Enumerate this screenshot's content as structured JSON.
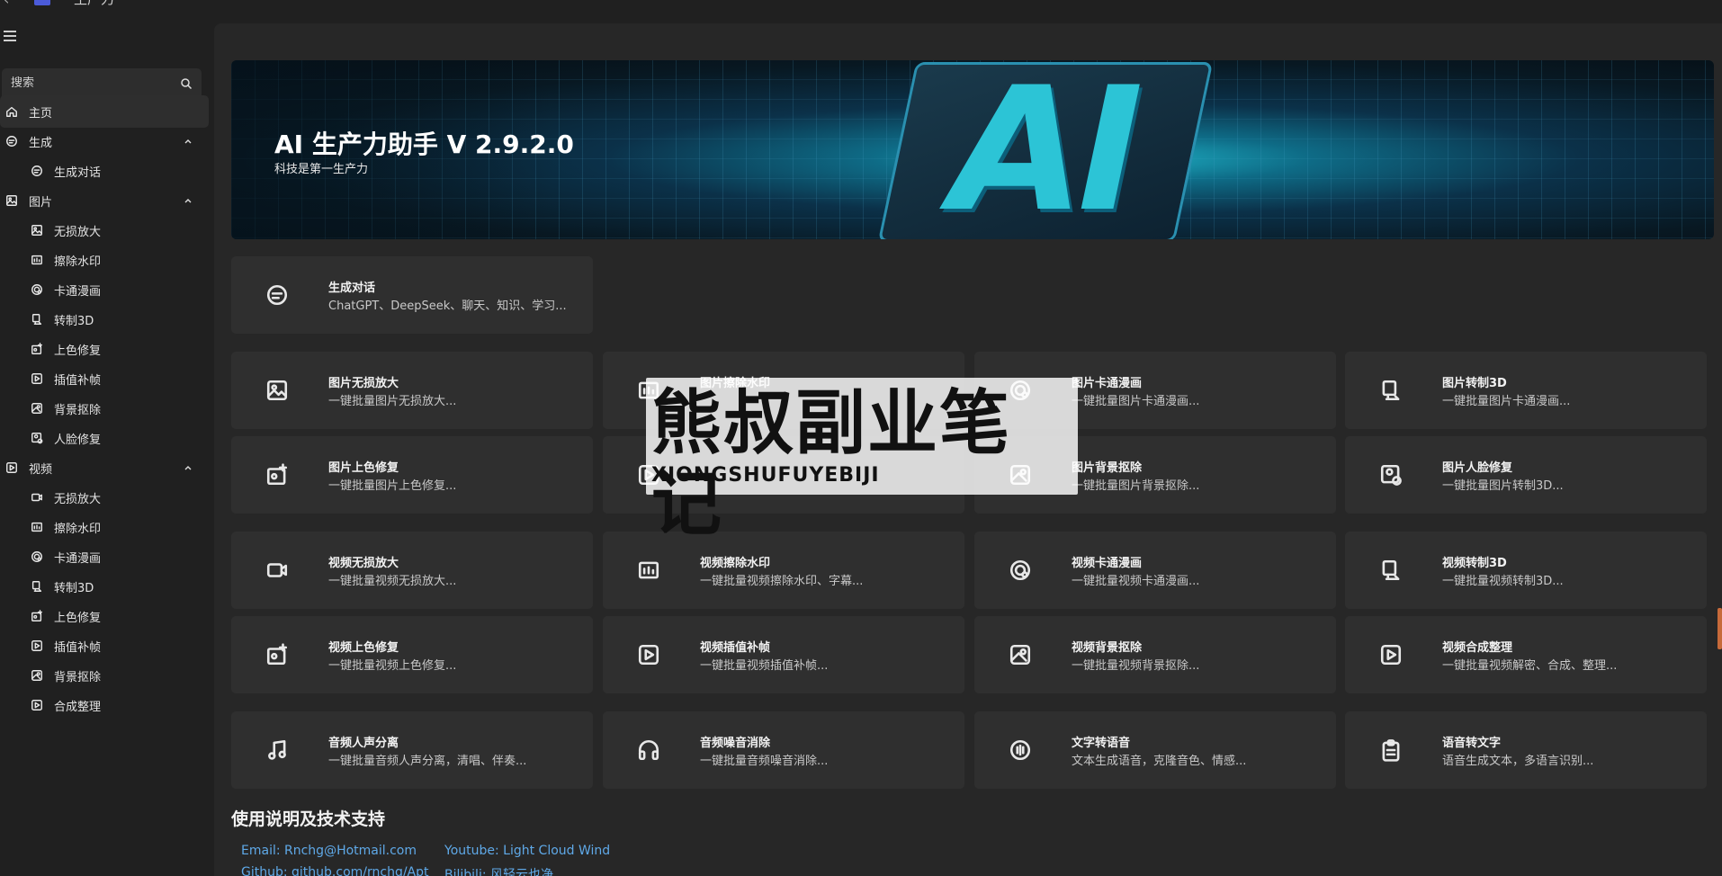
{
  "app": {
    "title": "生产力"
  },
  "sidebar": {
    "search_placeholder": "搜索",
    "items": [
      {
        "label": "主页",
        "icon": "home-icon"
      },
      {
        "label": "生成",
        "icon": "chat-icon"
      },
      {
        "label": "生成对话",
        "icon": "chat-icon"
      },
      {
        "label": "图片",
        "icon": "image-icon"
      },
      {
        "label": "无损放大",
        "icon": "image-icon"
      },
      {
        "label": "擦除水印",
        "icon": "watermark-icon"
      },
      {
        "label": "卡通漫画",
        "icon": "cartoon-icon"
      },
      {
        "label": "转制3D",
        "icon": "3d-icon"
      },
      {
        "label": "上色修复",
        "icon": "colorize-icon"
      },
      {
        "label": "插值补帧",
        "icon": "play-icon"
      },
      {
        "label": "背景抠除",
        "icon": "background-icon"
      },
      {
        "label": "人脸修复",
        "icon": "face-icon"
      },
      {
        "label": "视频",
        "icon": "video-icon"
      },
      {
        "label": "无损放大",
        "icon": "video-camera-icon"
      },
      {
        "label": "擦除水印",
        "icon": "watermark-icon"
      },
      {
        "label": "卡通漫画",
        "icon": "cartoon-icon"
      },
      {
        "label": "转制3D",
        "icon": "3d-icon"
      },
      {
        "label": "上色修复",
        "icon": "colorize-icon"
      },
      {
        "label": "插值补帧",
        "icon": "play-icon"
      },
      {
        "label": "背景抠除",
        "icon": "background-icon"
      },
      {
        "label": "合成整理",
        "icon": "play-icon"
      }
    ]
  },
  "banner": {
    "title": "AI 生产力助手 V 2.9.2.0",
    "subtitle": "科技是第一生产力",
    "art_text": "AI"
  },
  "cards": [
    {
      "title": "生成对话",
      "desc": "ChatGPT、DeepSeek、聊天、知识、学习...",
      "icon": "chat-icon"
    },
    {
      "title": "图片无损放大",
      "desc": "一键批量图片无损放大...",
      "icon": "image-icon"
    },
    {
      "title": "图片擦除水印",
      "desc": "",
      "icon": "watermark-icon"
    },
    {
      "title": "图片卡通漫画",
      "desc": "一键批量图片卡通漫画...",
      "icon": "cartoon-icon"
    },
    {
      "title": "图片转制3D",
      "desc": "一键批量图片卡通漫画...",
      "icon": "3d-icon"
    },
    {
      "title": "图片上色修复",
      "desc": "一键批量图片上色修复...",
      "icon": "colorize-icon"
    },
    {
      "title": "",
      "desc": "",
      "icon": "play-icon"
    },
    {
      "title": "图片背景抠除",
      "desc": "一键批量图片背景抠除...",
      "icon": "background-icon"
    },
    {
      "title": "图片人脸修复",
      "desc": "一键批量图片转制3D...",
      "icon": "face-icon"
    },
    {
      "title": "视频无损放大",
      "desc": "一键批量视频无损放大...",
      "icon": "video-camera-icon"
    },
    {
      "title": "视频擦除水印",
      "desc": "一键批量视频擦除水印、字幕...",
      "icon": "watermark-icon"
    },
    {
      "title": "视频卡通漫画",
      "desc": "一键批量视频卡通漫画...",
      "icon": "cartoon-icon"
    },
    {
      "title": "视频转制3D",
      "desc": "一键批量视频转制3D...",
      "icon": "3d-icon"
    },
    {
      "title": "视频上色修复",
      "desc": "一键批量视频上色修复...",
      "icon": "colorize-icon"
    },
    {
      "title": "视频插值补帧",
      "desc": "一键批量视频插值补帧...",
      "icon": "play-icon"
    },
    {
      "title": "视频背景抠除",
      "desc": "一键批量视频背景抠除...",
      "icon": "background-icon"
    },
    {
      "title": "视频合成整理",
      "desc": "一键批量视频解密、合成、整理...",
      "icon": "play-icon"
    },
    {
      "title": "音频人声分离",
      "desc": "一键批量音频人声分离，清唱、伴奏...",
      "icon": "music-icon"
    },
    {
      "title": "音频噪音消除",
      "desc": "一键批量音频噪音消除...",
      "icon": "headphones-icon"
    },
    {
      "title": "文字转语音",
      "desc": "文本生成语音，克隆音色、情感...",
      "icon": "voice-icon"
    },
    {
      "title": "语音转文字",
      "desc": "语音生成文本，多语言识别...",
      "icon": "clipboard-icon"
    }
  ],
  "support": {
    "title": "使用说明及技术支持",
    "links": [
      {
        "text": "Email: Rnchg@Hotmail.com"
      },
      {
        "text": "Youtube: Light Cloud Wind"
      },
      {
        "text": "Github: github.com/rnchg/Apt"
      },
      {
        "text": "Bilibili: 风轻云也净"
      }
    ]
  },
  "watermark": {
    "line1": "熊叔副业笔记",
    "line2": "XIONGSHUFUYEBIJI"
  },
  "colors": {
    "background": "#202020",
    "panel": "#272727",
    "card": "#2f2f2f",
    "link": "#5fa9e8",
    "accent": "#2cc4d6"
  }
}
